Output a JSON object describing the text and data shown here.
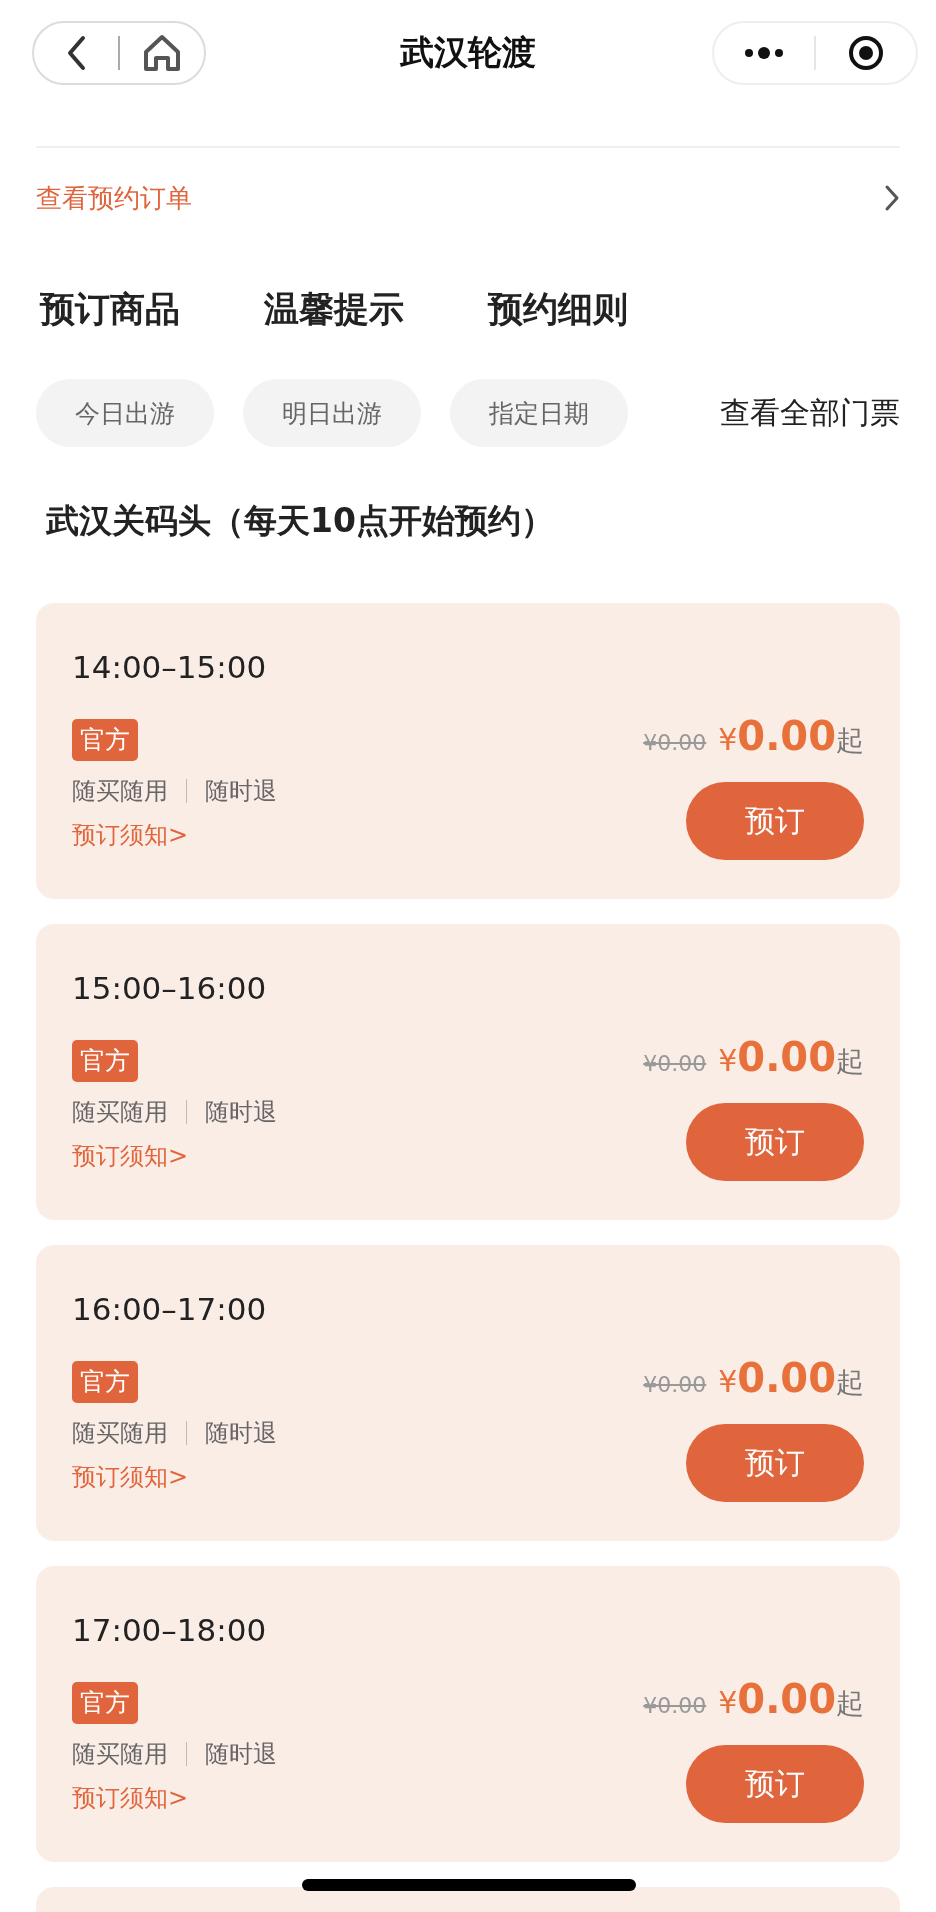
{
  "nav": {
    "title": "武汉轮渡"
  },
  "order_link": {
    "label": "查看预约订单"
  },
  "tabs": [
    {
      "label": "预订商品"
    },
    {
      "label": "温馨提示"
    },
    {
      "label": "预约细则"
    }
  ],
  "date_chips": [
    {
      "label": "今日出游"
    },
    {
      "label": "明日出游"
    },
    {
      "label": "指定日期"
    }
  ],
  "view_all": "查看全部门票",
  "section_title": "武汉关码头（每天10点开始预约）",
  "slots": [
    {
      "time": "14:00–15:00",
      "tag": "官方",
      "features": [
        "随买随用",
        "随时退"
      ],
      "notice": "预订须知>",
      "original_price": "¥0.00",
      "currency": "¥",
      "amount": "0.00",
      "suffix": "起",
      "button": "预订"
    },
    {
      "time": "15:00–16:00",
      "tag": "官方",
      "features": [
        "随买随用",
        "随时退"
      ],
      "notice": "预订须知>",
      "original_price": "¥0.00",
      "currency": "¥",
      "amount": "0.00",
      "suffix": "起",
      "button": "预订"
    },
    {
      "time": "16:00–17:00",
      "tag": "官方",
      "features": [
        "随买随用",
        "随时退"
      ],
      "notice": "预订须知>",
      "original_price": "¥0.00",
      "currency": "¥",
      "amount": "0.00",
      "suffix": "起",
      "button": "预订"
    },
    {
      "time": "17:00–18:00",
      "tag": "官方",
      "features": [
        "随买随用",
        "随时退"
      ],
      "notice": "预订须知>",
      "original_price": "¥0.00",
      "currency": "¥",
      "amount": "0.00",
      "suffix": "起",
      "button": "预订"
    }
  ]
}
